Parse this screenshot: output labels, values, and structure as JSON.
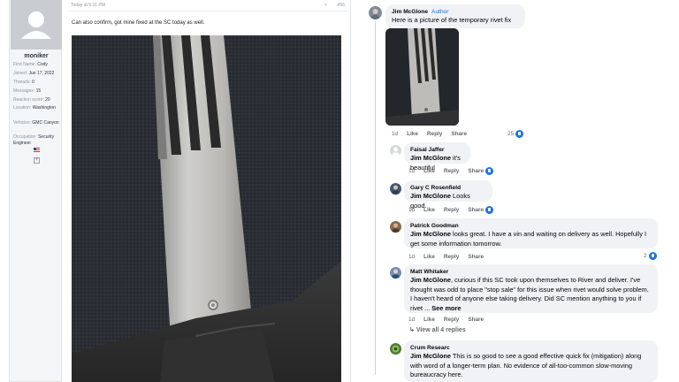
{
  "forum": {
    "user": {
      "name": "moniker",
      "stats": [
        {
          "k": "First Name:",
          "v": "Cody"
        },
        {
          "k": "Joined:",
          "v": "Jun 17, 2022"
        },
        {
          "k": "Threads:",
          "v": "0"
        },
        {
          "k": "Messages:",
          "v": "15"
        },
        {
          "k": "Reaction score:",
          "v": "20"
        },
        {
          "k": "Location:",
          "v": "Washington"
        },
        {
          "k": "Vehicles:",
          "v": "GMC Canyon"
        },
        {
          "k": "Occupation:",
          "v": "Security Engineer"
        }
      ]
    },
    "post": {
      "timestamp": "Today at 5:31 PM",
      "number": "#56",
      "text": "Can also confirm, got mine fixed at the SC today as well."
    }
  },
  "facebook": {
    "main": {
      "author": "Jim McGlone",
      "badge": "Author",
      "text": "Here is a picture of the temporary rivet fix",
      "time": "1d",
      "like": "Like",
      "reply": "Reply",
      "share": "Share",
      "reactions": "25"
    },
    "comments": [
      {
        "author": "Faisal Jaffer",
        "mention": "Jim McGlone",
        "text": " it's beautiful",
        "time": "1d",
        "reactions": ""
      },
      {
        "author": "Gary C Rosenfield",
        "mention": "Jim McGlone",
        "text": " Looks good.",
        "time": "1d",
        "reactions": ""
      },
      {
        "author": "Patrick Goodman",
        "mention": "Jim McGlone",
        "text": " looks great. I have a vin and waiting on delivery as well. Hopefully I get some information tomorrow.",
        "time": "1d",
        "reactions": "2"
      },
      {
        "author": "Matt Whitaker",
        "mention": "Jim McGlone",
        "text": ", curious if this SC took upon themselves to River and deliver. I've thought was odd to place \"stop sale\" for this issue when rivet would solve problem. I haven't heard of anyone else taking delivery. Did SC mention anything to you if rivet ... ",
        "see_more": "See more",
        "time": "1d",
        "reactions": ""
      },
      {
        "author": "Crum Researc",
        "mention": "Jim McGlone",
        "text": " This is so good to see a good effective quick fix (mitigation) along with word of a longer-term plan. No evidence of all-too-common slow-moving bureaucracy here.",
        "time": "",
        "reactions": ""
      }
    ],
    "view_replies": "View all 4 replies",
    "labels": {
      "like": "Like",
      "reply": "Reply",
      "share": "Share"
    }
  }
}
